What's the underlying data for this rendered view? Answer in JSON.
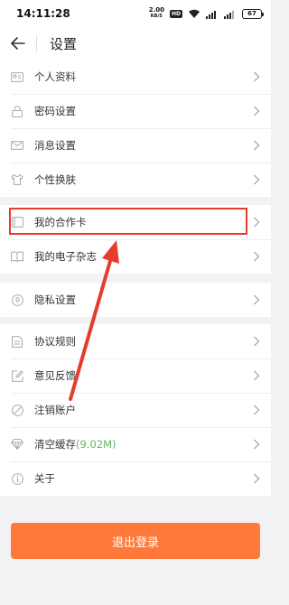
{
  "status_bar": {
    "time": "14:11:28",
    "net_rate_value": "2.00",
    "net_rate_unit": "KB/S",
    "hd": "HD",
    "battery": "67"
  },
  "header": {
    "title": "设置"
  },
  "groups": [
    {
      "items": [
        {
          "label": "个人资料",
          "icon": "id-card-icon"
        },
        {
          "label": "密码设置",
          "icon": "lock-icon"
        },
        {
          "label": "消息设置",
          "icon": "mail-icon"
        },
        {
          "label": "个性换肤",
          "icon": "shirt-icon"
        }
      ]
    },
    {
      "items": [
        {
          "label": "我的合作卡",
          "icon": "card-icon"
        },
        {
          "label": "我的电子杂志",
          "icon": "book-icon"
        }
      ]
    },
    {
      "items": [
        {
          "label": "隐私设置",
          "icon": "privacy-icon"
        }
      ]
    },
    {
      "items": [
        {
          "label": "协议规则",
          "icon": "document-icon"
        },
        {
          "label": "意见反馈",
          "icon": "edit-icon"
        },
        {
          "label": "注销账户",
          "icon": "cancel-icon"
        },
        {
          "label": "清空缓存",
          "extra": "(9.02M)",
          "icon": "clear-cache-icon"
        },
        {
          "label": "关于",
          "icon": "info-icon"
        }
      ]
    }
  ],
  "logout": {
    "label": "退出登录"
  },
  "colors": {
    "accent": "#ff7a3a",
    "highlight": "#e63b2e",
    "cache_size": "#5cb85c"
  }
}
